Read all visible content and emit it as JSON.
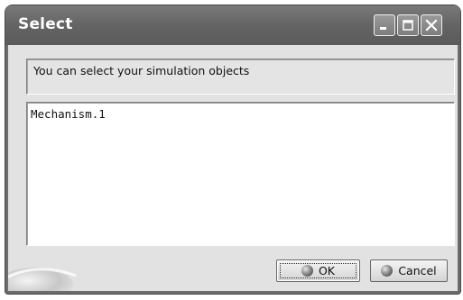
{
  "window": {
    "title": "Select"
  },
  "titlebar_buttons": {
    "minimize_icon": "minimize-icon",
    "maximize_icon": "maximize-icon",
    "close_icon": "close-icon"
  },
  "message": {
    "text": "You can select your simulation objects"
  },
  "list": {
    "items": [
      "Mechanism.1"
    ]
  },
  "buttons": {
    "ok_label": "OK",
    "cancel_label": "Cancel",
    "ok_icon": "ok-ball-icon",
    "cancel_icon": "cancel-ball-icon"
  }
}
